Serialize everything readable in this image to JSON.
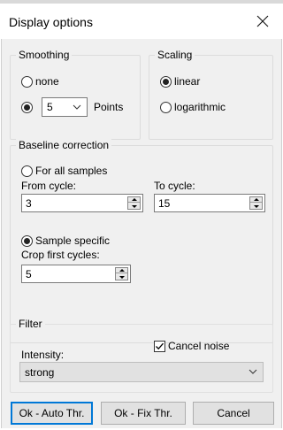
{
  "window": {
    "title": "Display options"
  },
  "smoothing": {
    "legend": "Smoothing",
    "none_label": "none",
    "points_value": "5",
    "points_label": "Points"
  },
  "scaling": {
    "legend": "Scaling",
    "linear_label": "linear",
    "log_label": "logarithmic"
  },
  "baseline": {
    "legend": "Baseline correction",
    "all_samples_label": "For all samples",
    "from_label": "From cycle:",
    "from_value": "3",
    "to_label": "To cycle:",
    "to_value": "15",
    "specific_label": "Sample specific",
    "crop_label": "Crop first cycles:",
    "crop_value": "5"
  },
  "filter": {
    "legend": "Filter",
    "intensity_label": "Intensity:",
    "cancel_noise_label": "Cancel noise",
    "cancel_noise_checked": true,
    "intensity_value": "strong"
  },
  "buttons": {
    "auto_label": "Ok - Auto Thr.",
    "fix_label": "Ok - Fix Thr.",
    "cancel_label": "Cancel"
  },
  "colors": {
    "accent": "#0078d7",
    "panel": "#f0f0f0"
  }
}
